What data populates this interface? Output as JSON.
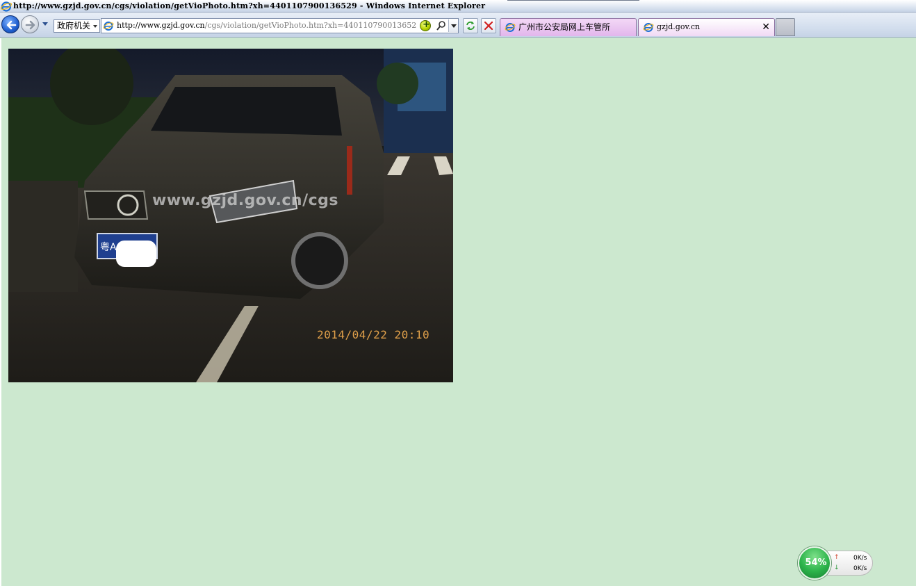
{
  "window": {
    "title": "http://www.gzjd.gov.cn/cgs/violation/getVioPhoto.htm?xh=4401107900136529 - Windows Internet Explorer"
  },
  "navbar": {
    "favorites_combo": "政府机关",
    "address_url_host": "http://www.gzjd.gov.cn",
    "address_url_path": "/cgs/violation/getVioPhoto.htm?xh=4401107900136529"
  },
  "tabs": [
    {
      "label": "广州市公安局网上车管所"
    },
    {
      "label": "gzjd.gov.cn"
    }
  ],
  "photo": {
    "watermark": "www.gzjd.gov.cn/cgs",
    "timestamp": "2014/04/22  20:10",
    "plate_prefix": "粤A"
  },
  "speed_widget": {
    "percent": "54%",
    "upload": "0K/s",
    "download": "0K/s"
  },
  "colors": {
    "page_background": "#cce8cf",
    "tab_active": "#e2b6ec",
    "timestamp": "#e0a04a",
    "orb": "#2bb34a"
  },
  "icons": [
    "ie-logo-icon",
    "back-arrow-icon",
    "forward-arrow-icon",
    "chevron-down-icon",
    "compat-view-icon",
    "search-icon",
    "refresh-icon",
    "stop-icon",
    "close-icon"
  ]
}
